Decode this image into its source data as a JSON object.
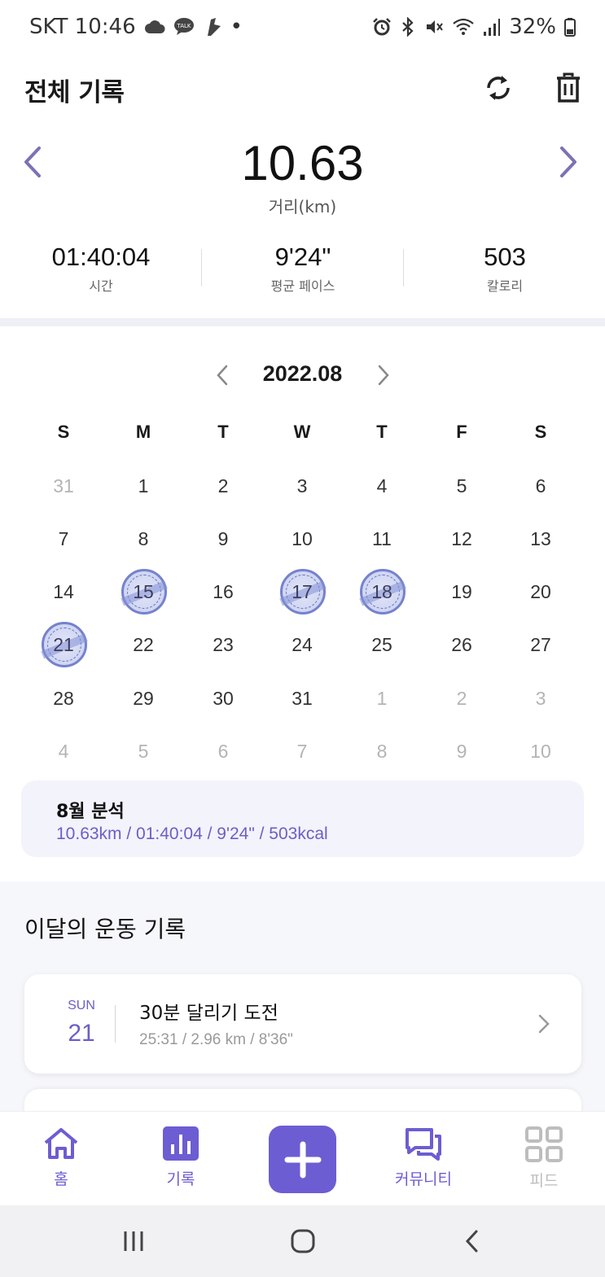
{
  "status_bar": {
    "carrier_time": "SKT 10:46",
    "dot": "•",
    "battery": "32%",
    "left_icons": [
      "cloud-icon",
      "kakaotalk-icon",
      "app-notification-icon"
    ],
    "right_icons": [
      "alarm-icon",
      "bluetooth-icon",
      "mute-icon",
      "wifi-icon",
      "signal-icon",
      "battery-icon"
    ]
  },
  "header": {
    "title": "전체 기록",
    "icons": [
      "refresh-icon",
      "trash-icon"
    ]
  },
  "summary": {
    "distance": "10.63",
    "distance_label": "거리(km)",
    "stats": [
      {
        "value": "01:40:04",
        "label": "시간"
      },
      {
        "value": "9'24\"",
        "label": "평균 페이스"
      },
      {
        "value": "503",
        "label": "칼로리"
      }
    ]
  },
  "calendar": {
    "month": "2022.08",
    "weekdays": [
      "S",
      "M",
      "T",
      "W",
      "T",
      "F",
      "S"
    ],
    "weeks": [
      [
        {
          "d": "31",
          "m": true
        },
        {
          "d": "1"
        },
        {
          "d": "2"
        },
        {
          "d": "3"
        },
        {
          "d": "4"
        },
        {
          "d": "5"
        },
        {
          "d": "6"
        }
      ],
      [
        {
          "d": "7"
        },
        {
          "d": "8"
        },
        {
          "d": "9"
        },
        {
          "d": "10"
        },
        {
          "d": "11"
        },
        {
          "d": "12"
        },
        {
          "d": "13"
        }
      ],
      [
        {
          "d": "14"
        },
        {
          "d": "15",
          "s": true
        },
        {
          "d": "16"
        },
        {
          "d": "17",
          "s": true
        },
        {
          "d": "18",
          "s": true
        },
        {
          "d": "19"
        },
        {
          "d": "20"
        }
      ],
      [
        {
          "d": "21",
          "s": true
        },
        {
          "d": "22"
        },
        {
          "d": "23"
        },
        {
          "d": "24"
        },
        {
          "d": "25"
        },
        {
          "d": "26"
        },
        {
          "d": "27"
        }
      ],
      [
        {
          "d": "28"
        },
        {
          "d": "29"
        },
        {
          "d": "30"
        },
        {
          "d": "31"
        },
        {
          "d": "1",
          "m": true
        },
        {
          "d": "2",
          "m": true
        },
        {
          "d": "3",
          "m": true
        }
      ],
      [
        {
          "d": "4",
          "m": true
        },
        {
          "d": "5",
          "m": true
        },
        {
          "d": "6",
          "m": true
        },
        {
          "d": "7",
          "m": true
        },
        {
          "d": "8",
          "m": true
        },
        {
          "d": "9",
          "m": true
        },
        {
          "d": "10",
          "m": true
        }
      ]
    ]
  },
  "analysis": {
    "title": "8월 분석",
    "summary": "10.63km / 01:40:04 / 9'24\" / 503kcal"
  },
  "records": {
    "title": "이달의 운동 기록",
    "items": [
      {
        "dow": "SUN",
        "day": "21",
        "name": "30분 달리기 도전",
        "meta": "25:31 / 2.96 km / 8'36\""
      }
    ]
  },
  "bottom_nav": {
    "items": [
      {
        "label": "홈",
        "icon": "home-icon",
        "color": "#6c5dd3"
      },
      {
        "label": "기록",
        "icon": "chart-icon",
        "color": "#6c5dd3"
      },
      {
        "label": "커뮤니티",
        "icon": "chat-icon",
        "color": "#6c5dd3"
      },
      {
        "label": "피드",
        "icon": "grid-icon",
        "color": "#bdbdbd"
      }
    ],
    "add_icon": "plus-icon"
  },
  "colors": {
    "accent": "#6c5dd3",
    "stamp": "#6a78c8"
  }
}
